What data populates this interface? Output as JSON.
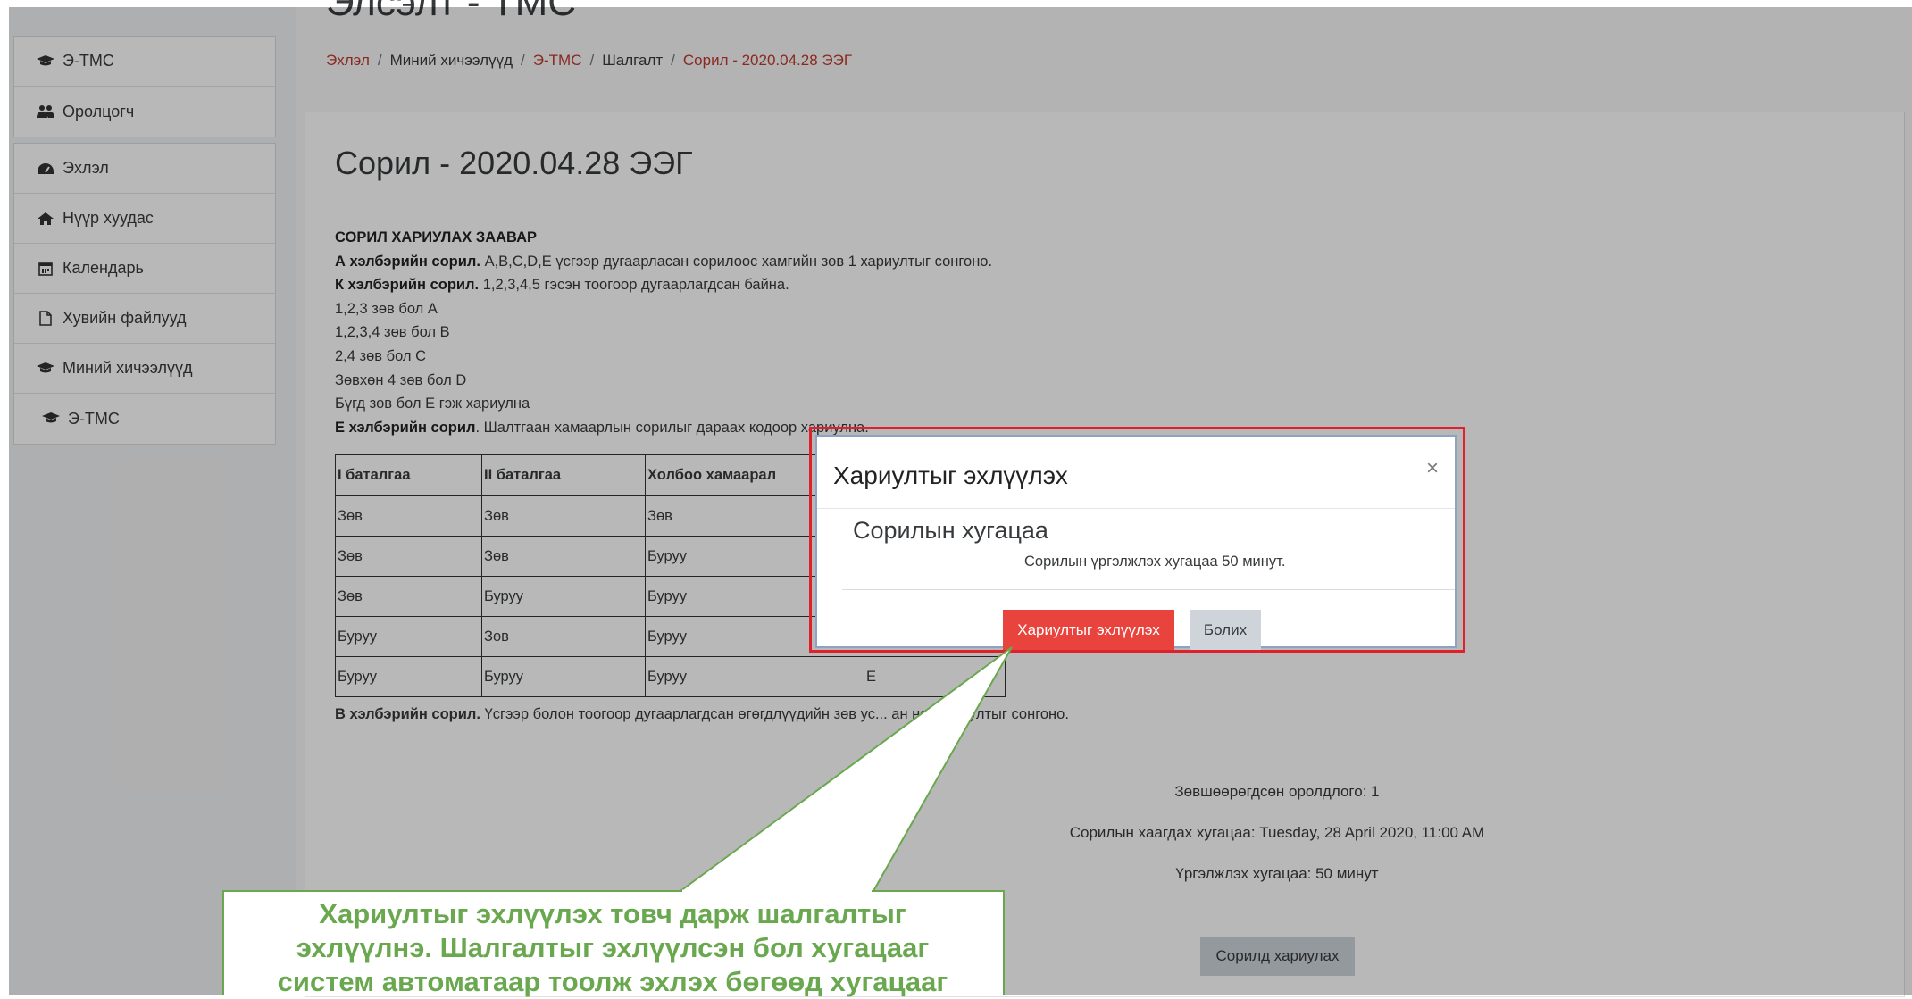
{
  "page": {
    "heading_top": "Элсэлт - ТМС",
    "breadcrumb": {
      "home": "Эхлэл",
      "my_courses": "Миний хичээлүүд",
      "course": "Э-ТМС",
      "section": "Шалгалт",
      "current": "Сорил - 2020.04.28 ЭЭГ",
      "separator": "/"
    }
  },
  "sidebar": {
    "group1": [
      {
        "icon": "graduation-cap-icon",
        "label": "Э-ТМС"
      },
      {
        "icon": "users-icon",
        "label": "Оролцогч"
      }
    ],
    "group2": [
      {
        "icon": "dashboard-icon",
        "label": "Эхлэл"
      },
      {
        "icon": "home-icon",
        "label": "Нүүр хуудас"
      },
      {
        "icon": "calendar-icon",
        "label": "Календарь"
      },
      {
        "icon": "file-icon",
        "label": "Хувийн файлууд"
      },
      {
        "icon": "graduation-cap-icon",
        "label": "Миний хичээлүүд"
      },
      {
        "icon": "graduation-cap-icon",
        "label": "Э-ТМС"
      }
    ]
  },
  "quiz": {
    "title": "Сорил - 2020.04.28 ЭЭГ",
    "instructions_heading": "СОРИЛ ХАРИУЛАХ ЗААВАР",
    "a_type_bold": "А хэлбэрийн сорил.",
    "a_type_text": " A,B,C,D,E үсгээр дугаарласан сорилоос хамгийн зөв 1 хариултыг сонгоно.",
    "k_type_bold": "К хэлбэрийн сорил.",
    "k_type_text": " 1,2,3,4,5 гэсэн тоогоор дугаарлагдсан байна.",
    "k_rule_1": "1,2,3 зөв бол A",
    "k_rule_2": "1,2,3,4 зөв бол B",
    "k_rule_3": "2,4 зөв бол C",
    "k_rule_4": "Зөвхөн 4 зөв бол D",
    "k_rule_5": "Бүгд зөв бол E гэж хариулна",
    "e_type_bold": "Е хэлбэрийн сорил",
    "e_type_text": ". Шалтгаан хамаарлын сорилыг дараах кодоор хариулна.",
    "table": {
      "headers": [
        "I баталгаа",
        "II баталгаа",
        "Холбоо хамаарал",
        ""
      ],
      "rows": [
        [
          "Зөв",
          "Зөв",
          "Зөв",
          ""
        ],
        [
          "Зөв",
          "Зөв",
          "Буруу",
          ""
        ],
        [
          "Зөв",
          "Буруу",
          "Буруу",
          ""
        ],
        [
          "Буруу",
          "Зөв",
          "Буруу",
          ""
        ],
        [
          "Буруу",
          "Буруу",
          "Буруу",
          "E"
        ]
      ]
    },
    "b_type_bold": "В хэлбэрийн сорил.",
    "b_type_text": " Үсгээр болон тоогоор дугаарлагдсан өгөгдлүүдийн зөв ус... ан нэг хариултыг сонгоно.",
    "attempts_allowed": "Зөвшөөрөгдсөн оролдлого: 1",
    "close_time": "Сорилын хаагдах хугацаа: Tuesday, 28 April 2020, 11:00 AM",
    "duration": "Үргэлжлэх хугацаа: 50 минут",
    "attempt_button": "Сорилд хариулах"
  },
  "modal": {
    "title": "Хариултыг эхлүүлэх",
    "close_symbol": "×",
    "subtitle": "Сорилын хугацаа",
    "text": "Сорилын үргэлжлэх хугацаа 50 минут.",
    "start_button": "Хариултыг эхлүүлэх",
    "cancel_button": "Болих"
  },
  "callout": {
    "line1": "Хариултыг эхлүүлэх товч дарж шалгалтыг",
    "line2": "эхлүүлнэ. Шалгалтыг эхлүүлсэн бол хугацааг",
    "line3": "систем автоматаар тоолж эхлэх бөгөөд хугацааг"
  },
  "colors": {
    "accent": "#e8433d",
    "link": "#c0392b",
    "callout": "#6aa84f",
    "highlight": "#e0202a"
  }
}
